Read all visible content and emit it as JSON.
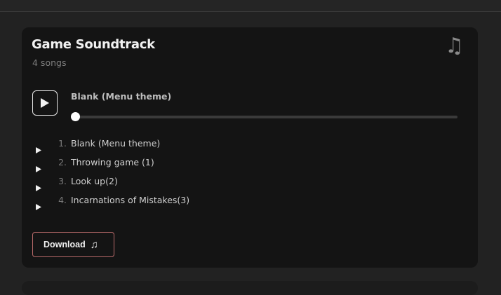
{
  "card": {
    "title": "Game Soundtrack",
    "subtitle": "4 songs",
    "icon": "music-note-icon"
  },
  "player": {
    "now_playing": "Blank (Menu theme)",
    "progress": 0.0,
    "play_icon": "play-icon"
  },
  "tracks": [
    {
      "number": "1.",
      "name": "Blank (Menu theme)"
    },
    {
      "number": "2.",
      "name": "Throwing game (1)"
    },
    {
      "number": "3.",
      "name": "Look up(2)"
    },
    {
      "number": "4.",
      "name": "Incarnations of Mistakes(3)"
    }
  ],
  "download": {
    "label": "Download",
    "icon": "music-note-icon"
  },
  "colors": {
    "background": "#222222",
    "card": "#141414",
    "accent_border": "#b96a6a"
  }
}
